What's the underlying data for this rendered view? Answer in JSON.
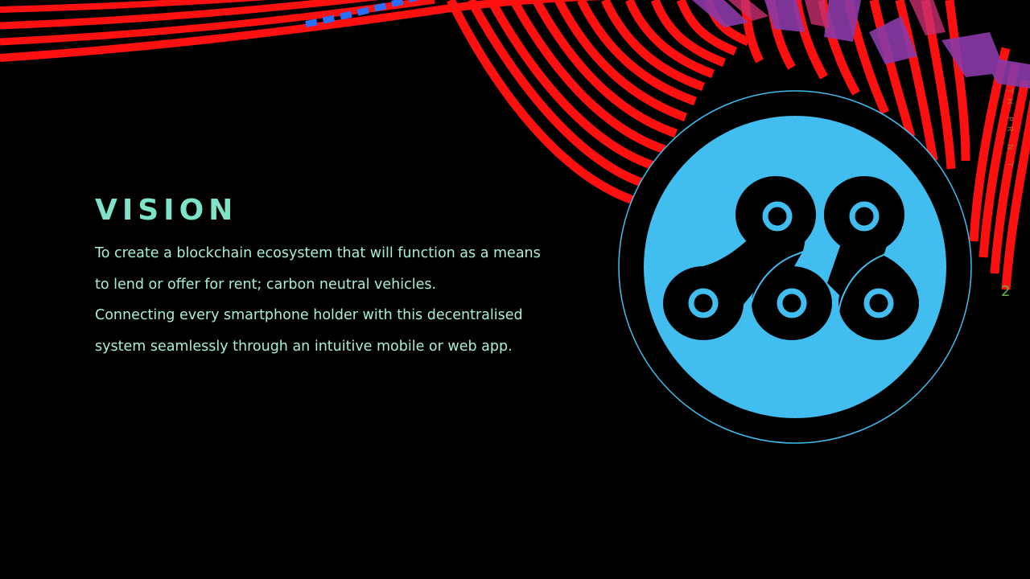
{
  "slide": {
    "title": "VISION",
    "paragraphs": [
      "To create a blockchain ecosystem that will function as a means to lend or offer for rent; carbon neutral vehicles.",
      "Connecting every smartphone holder with this decentralised system seamlessly through an intuitive mobile or web app."
    ],
    "page_number": "2",
    "side_text": "TH PR N T"
  },
  "logo": {
    "icon": "bike-chain-icon"
  },
  "colors": {
    "background": "#000000",
    "title": "#7ee3c9",
    "body_text": "#a8efd9",
    "ribbon_red": "#ff1010",
    "ribbon_blue": "#2a6dff",
    "ribbon_purple": "#8a3aa8",
    "logo_fill": "#41bdf0",
    "logo_ring": "#41bdf0",
    "page_number": "#6cae4c"
  }
}
